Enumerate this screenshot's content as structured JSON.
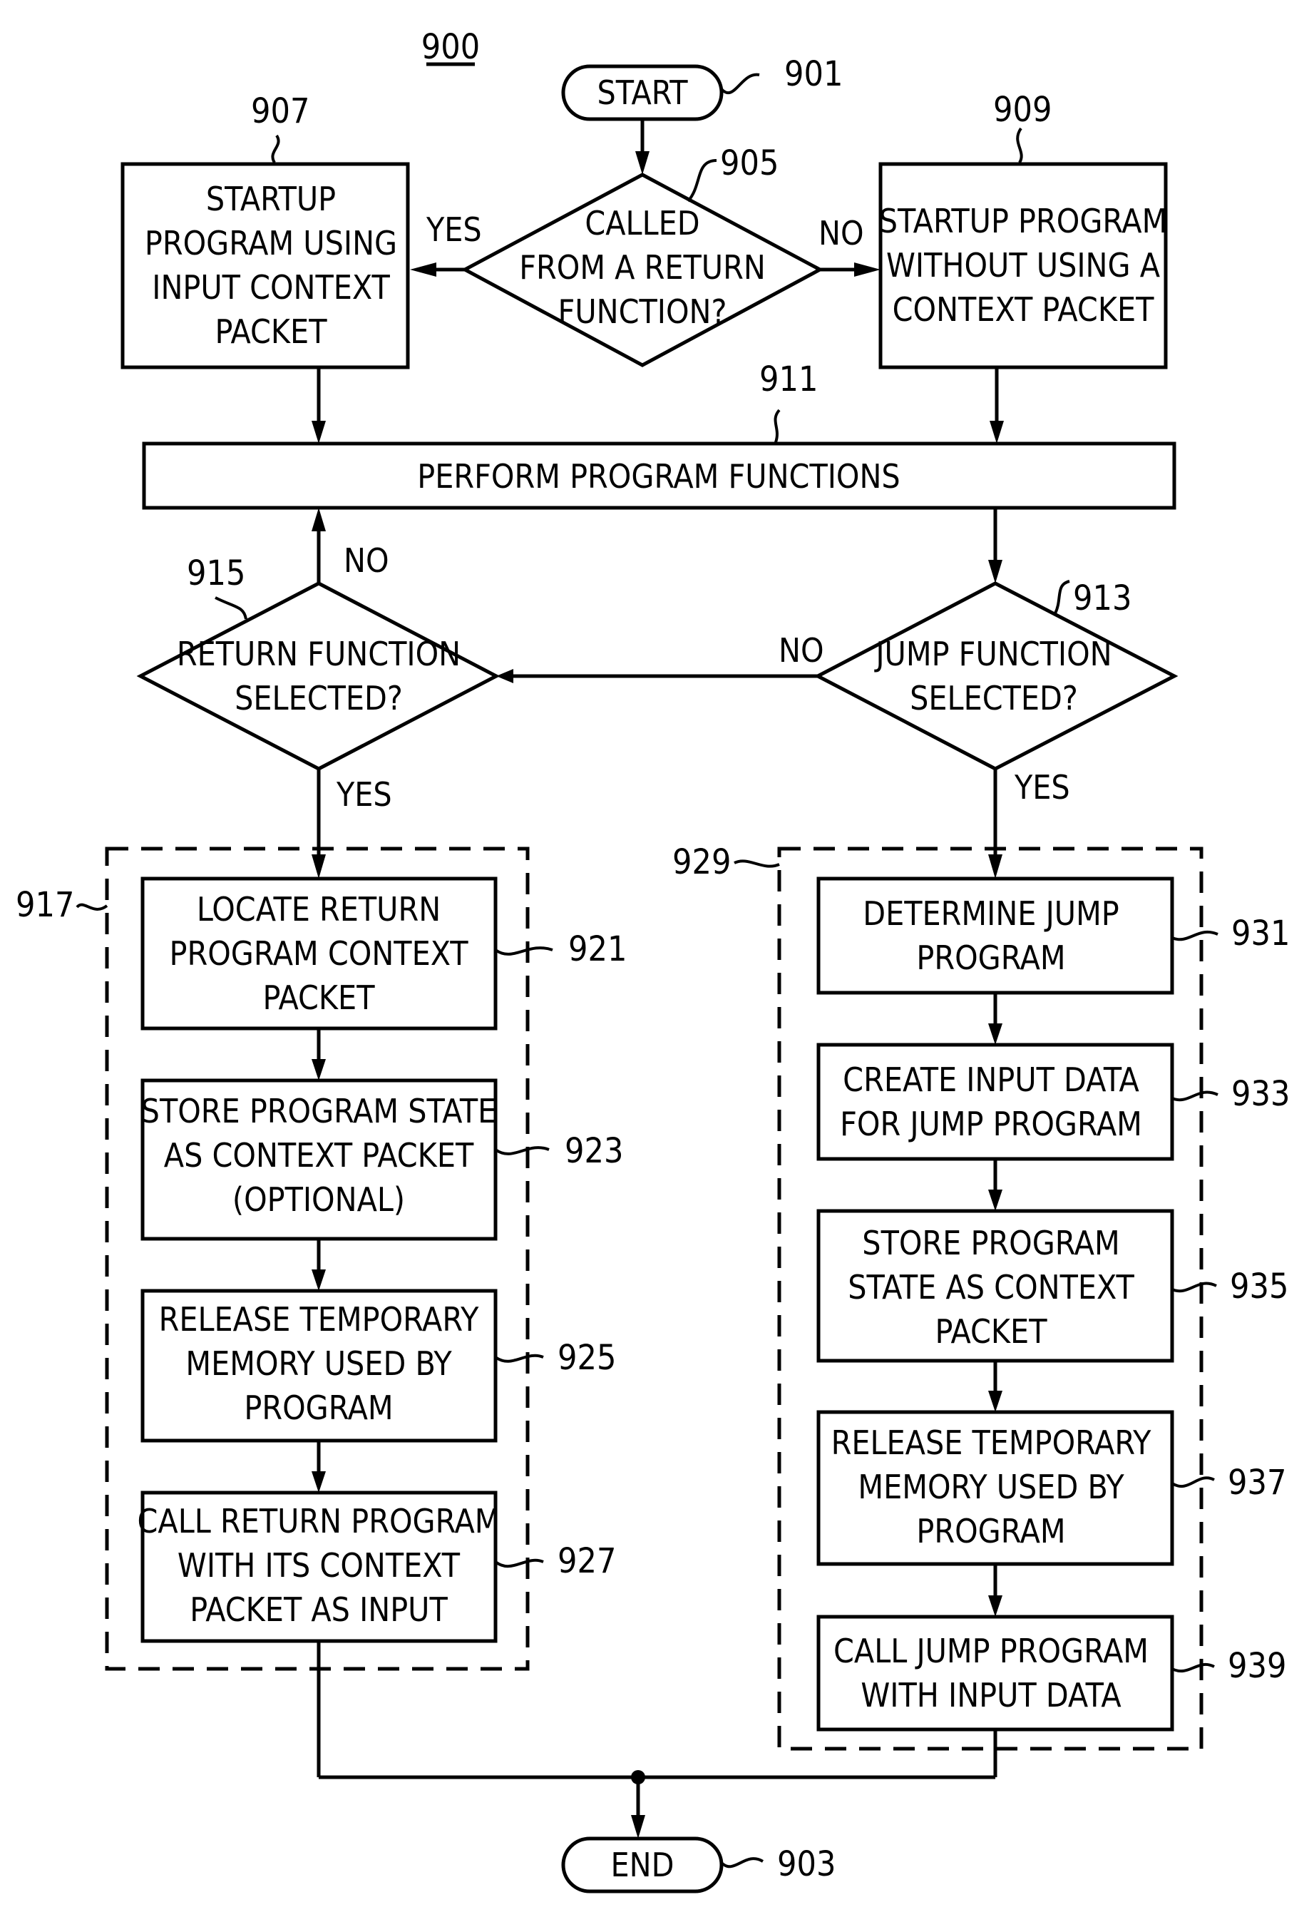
{
  "figure": {
    "number": "900",
    "colors": {
      "stroke": "#000000",
      "background": "#ffffff"
    }
  },
  "nodes": {
    "start": {
      "ref": "901",
      "lines": [
        "START"
      ]
    },
    "end": {
      "ref": "903",
      "lines": [
        "END"
      ]
    },
    "called_from_return": {
      "ref": "905",
      "lines": [
        "CALLED",
        "FROM A RETURN",
        "FUNCTION?"
      ]
    },
    "startup_with_context": {
      "ref": "907",
      "lines": [
        "STARTUP",
        "PROGRAM USING",
        "INPUT CONTEXT",
        "PACKET"
      ]
    },
    "startup_without_context": {
      "ref": "909",
      "lines": [
        "STARTUP PROGRAM",
        "WITHOUT USING A",
        "CONTEXT PACKET"
      ]
    },
    "perform_functions": {
      "ref": "911",
      "lines": [
        "PERFORM PROGRAM FUNCTIONS"
      ]
    },
    "jump_selected": {
      "ref": "913",
      "lines": [
        "JUMP FUNCTION",
        "SELECTED?"
      ]
    },
    "return_selected": {
      "ref": "915",
      "lines": [
        "RETURN FUNCTION",
        "SELECTED?"
      ]
    },
    "return_group": {
      "ref": "917"
    },
    "locate_return": {
      "ref": "921",
      "lines": [
        "LOCATE RETURN",
        "PROGRAM CONTEXT",
        "PACKET"
      ]
    },
    "store_state_optional": {
      "ref": "923",
      "lines": [
        "STORE PROGRAM STATE",
        "AS CONTEXT PACKET",
        "(OPTIONAL)"
      ]
    },
    "release_memory_return": {
      "ref": "925",
      "lines": [
        "RELEASE TEMPORARY",
        "MEMORY USED BY",
        "PROGRAM"
      ]
    },
    "call_return": {
      "ref": "927",
      "lines": [
        "CALL RETURN PROGRAM",
        "WITH ITS CONTEXT",
        "PACKET AS INPUT"
      ]
    },
    "jump_group": {
      "ref": "929"
    },
    "determine_jump": {
      "ref": "931",
      "lines": [
        "DETERMINE JUMP",
        "PROGRAM"
      ]
    },
    "create_input": {
      "ref": "933",
      "lines": [
        "CREATE INPUT DATA",
        "FOR JUMP PROGRAM"
      ]
    },
    "store_state_jump": {
      "ref": "935",
      "lines": [
        "STORE PROGRAM",
        "STATE AS CONTEXT",
        "PACKET"
      ]
    },
    "release_memory_jump": {
      "ref": "937",
      "lines": [
        "RELEASE TEMPORARY",
        "MEMORY USED BY",
        "PROGRAM"
      ]
    },
    "call_jump": {
      "ref": "939",
      "lines": [
        "CALL JUMP PROGRAM",
        "WITH INPUT DATA"
      ]
    }
  },
  "edge_labels": {
    "called_yes": "YES",
    "called_no": "NO",
    "return_no": "NO",
    "return_yes": "YES",
    "jump_no": "NO",
    "jump_yes": "YES"
  }
}
